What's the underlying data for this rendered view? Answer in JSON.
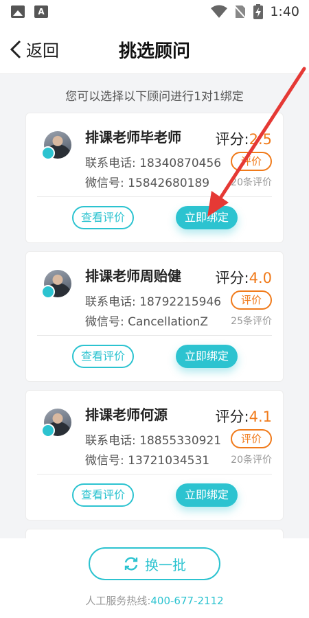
{
  "status_bar": {
    "time": "1:40",
    "left_icons": [
      "image-icon",
      "a-font-icon"
    ],
    "right_icons": [
      "wifi-icon",
      "no-sim-icon",
      "battery-charging-icon"
    ]
  },
  "nav": {
    "back_label": "返回",
    "title": "挑选顾问"
  },
  "hint": "您可以选择以下顾问进行1对1绑定",
  "advisors": [
    {
      "name": "排课老师毕老师",
      "score_label": "评分:",
      "score": "2.5",
      "phone": "联系电话: 18340870456",
      "wechat": "微信号: 15842680189",
      "eval_tag": "评价",
      "eval_count": "20条评价",
      "view_btn": "查看评价",
      "bind_btn": "立即绑定"
    },
    {
      "name": "排课老师周贻健",
      "score_label": "评分:",
      "score": "4.0",
      "phone": "联系电话: 18792215946",
      "wechat": "微信号: CancellationZ",
      "eval_tag": "评价",
      "eval_count": "25条评价",
      "view_btn": "查看评价",
      "bind_btn": "立即绑定"
    },
    {
      "name": "排课老师何源",
      "score_label": "评分:",
      "score": "4.1",
      "phone": "联系电话: 18855330921",
      "wechat": "微信号: 13721034531",
      "eval_tag": "评价",
      "eval_count": "20条评价",
      "view_btn": "查看评价",
      "bind_btn": "立即绑定"
    }
  ],
  "refresh_label": "换一批",
  "hotline": {
    "label": "人工服务热线:",
    "number": "400-677-2112"
  },
  "colors": {
    "accent": "#2cc3d0",
    "score": "#f07a1a",
    "annotation": "#e53935"
  }
}
